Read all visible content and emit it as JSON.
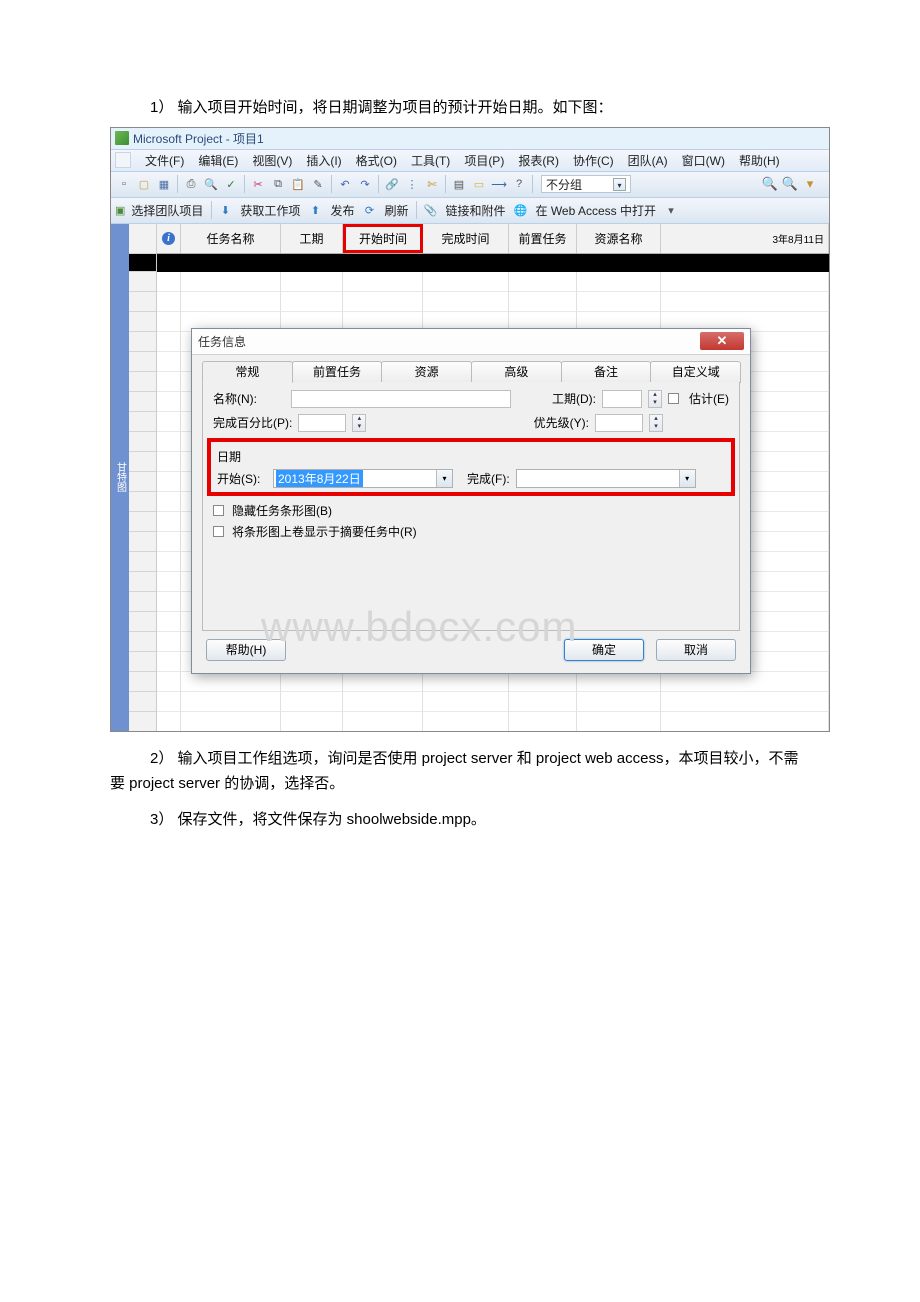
{
  "doc": {
    "step1": "1） 输入项目开始时间，将日期调整为项目的预计开始日期。如下图：",
    "step2_line1_num": "2）",
    "step2_text": "输入项目工作组选项，询问是否使用 project server 和 project web access，本项目较小，不需要 project server 的协调，选择否。",
    "step3": "3） 保存文件，将文件保存为 shoolwebside.mpp。"
  },
  "watermark": "www.bdocx.com",
  "app": {
    "title": "Microsoft Project - 项目1",
    "menus": {
      "file": "文件(F)",
      "edit": "编辑(E)",
      "view": "视图(V)",
      "insert": "插入(I)",
      "format": "格式(O)",
      "tools": "工具(T)",
      "project": "项目(P)",
      "report": "报表(R)",
      "collab": "协作(C)",
      "team": "团队(A)",
      "window": "窗口(W)",
      "help": "帮助(H)"
    },
    "toolbar2": {
      "select_team": "选择团队项目",
      "get_items": "获取工作项",
      "publish": "发布",
      "refresh": "刷新",
      "links": "链接和附件",
      "web_open": "在 Web Access 中打开"
    },
    "filter": "不分组",
    "columns": {
      "info": "i",
      "taskname": "任务名称",
      "duration": "工期",
      "start": "开始时间",
      "finish": "完成时间",
      "pred": "前置任务",
      "res": "资源名称",
      "date_frag": "3年8月11日"
    }
  },
  "dialog": {
    "title": "任务信息",
    "tabs": {
      "general": "常规",
      "pred": "前置任务",
      "res": "资源",
      "adv": "高级",
      "notes": "备注",
      "custom": "自定义域"
    },
    "labels": {
      "name": "名称(N):",
      "duration": "工期(D):",
      "estimate": "估计(E)",
      "percent": "完成百分比(P):",
      "priority": "优先级(Y):",
      "dates_header": "日期",
      "start": "开始(S):",
      "finish": "完成(F):",
      "hide_bar": "隐藏任务条形图(B)",
      "rollup": "将条形图上卷显示于摘要任务中(R)"
    },
    "start_value": "2013年8月22日",
    "buttons": {
      "help": "帮助(H)",
      "ok": "确定",
      "cancel": "取消"
    }
  }
}
